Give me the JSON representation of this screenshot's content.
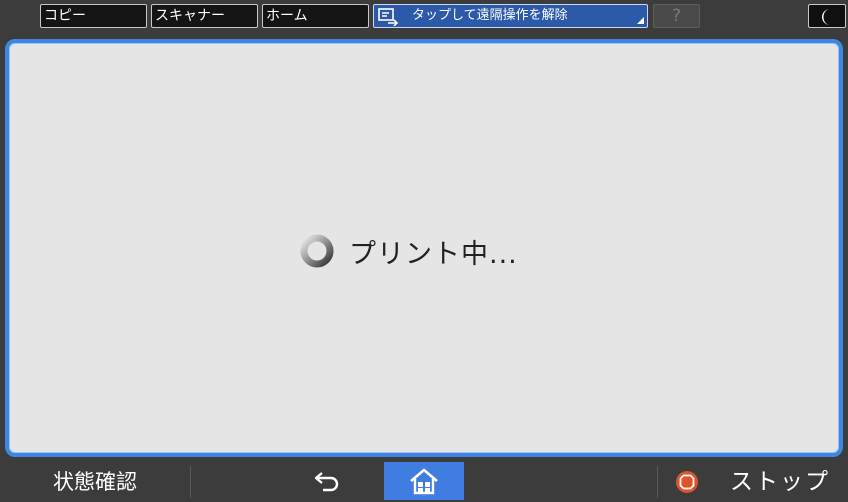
{
  "topbar": {
    "tabs": [
      {
        "label": "コピー"
      },
      {
        "label": "スキャナー"
      },
      {
        "label": "ホーム"
      }
    ],
    "remote": {
      "label": "タップして遠隔操作を解除",
      "icon": "remote-operation-icon"
    },
    "help_label": "?",
    "night_icon": "moon-icon"
  },
  "main": {
    "status_text": "プリント中...",
    "spinner_icon": "loading-spinner-icon"
  },
  "bottombar": {
    "status_check_label": "状態確認",
    "back_icon": "back-arrow-icon",
    "home_icon": "home-icon",
    "stop_label": "ストップ",
    "stop_icon": "stop-icon"
  },
  "colors": {
    "accent": "#3f86e4",
    "remote_bg": "#2c5aa8",
    "stop": "#e0532a",
    "panel_bg": "#e5e5e5"
  }
}
